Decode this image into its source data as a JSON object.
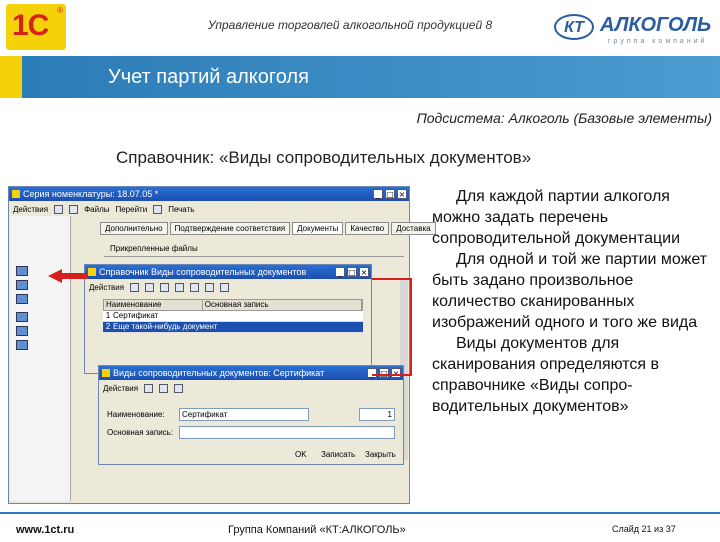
{
  "header": {
    "logo_1c": "1С",
    "title": "Управление торговлей алкогольной продукцией 8",
    "brand_mark": "КТ",
    "brand_name": "АЛКОГОЛЬ",
    "brand_sub": "группа компаний"
  },
  "slide": {
    "title": "Учет партий алкоголя",
    "subsystem": "Подсистема: Алкоголь (Базовые элементы)",
    "section": "Справочник: «Виды сопроводительных документов»",
    "paragraphs": [
      "Для каждой партии алкоголя можно задать перечень сопроводительной документации",
      "Для одной и той же партии может быть задано произвольное количество сканированных изображений одного и того же вида",
      "Виды документов для сканирования определяются в справочнике «Виды сопро-водительных документов»"
    ]
  },
  "back_window": {
    "title": "Серия номенклатуры: 18.07.05 *",
    "toolbar": [
      "Действия",
      "Файлы",
      "Перейти",
      "Печать"
    ],
    "tabs": [
      "Дополнительно",
      "Подтверждение соответствия",
      "Документы",
      "Качество",
      "Доставка"
    ],
    "label_attach": "Прикрепленные файлы"
  },
  "mid_window": {
    "title": "Справочник Виды сопроводительных документов",
    "toolbar": [
      "Действия"
    ],
    "columns": [
      "Наименование",
      "Основная запись"
    ],
    "rows": [
      {
        "n": "1",
        "name": "Сертификат"
      },
      {
        "n": "2",
        "name": "Еще такой-нибудь документ"
      }
    ]
  },
  "front_window": {
    "title": "Виды сопроводительных документов: Сертификат",
    "toolbar": [
      "Действия"
    ],
    "label_name": "Наименование:",
    "value_name": "Сертификат",
    "value_code": "1",
    "label_main": "Основная запись:",
    "buttons": {
      "ok": "OK",
      "save": "Записать",
      "close": "Закрыть"
    }
  },
  "footer": {
    "site": "www.1ct.ru",
    "company": "Группа Компаний «КТ:АЛКОГОЛЬ»",
    "slide_num": "Слайд 21 из 37"
  },
  "colors": {
    "band": "#2a7bb6",
    "accent_yellow": "#f5d10a",
    "red_frame": "#d62020"
  }
}
